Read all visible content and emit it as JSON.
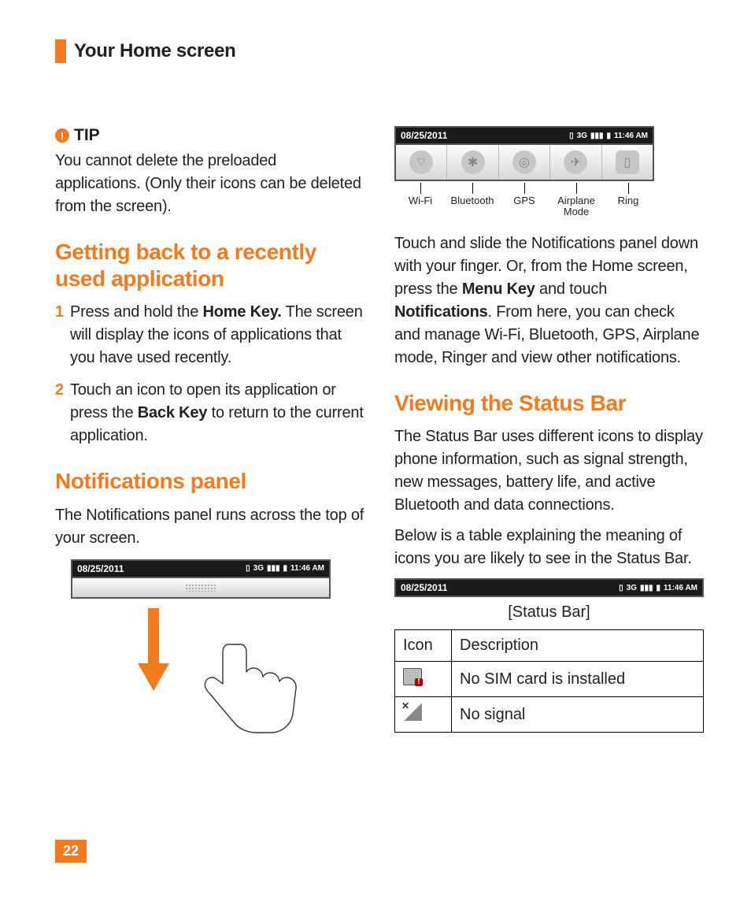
{
  "header": {
    "title": "Your Home screen"
  },
  "tip": {
    "label": "TIP",
    "body": "You cannot delete the preloaded applications. (Only their icons can be deleted from the screen)."
  },
  "section_recent": {
    "heading": "Getting back to a recently used application",
    "step1_num": "1",
    "step1_a": "Press and hold the ",
    "step1_bold": "Home Key.",
    "step1_b": " The screen will display the icons of applications that you have used recently.",
    "step2_num": "2",
    "step2_a": "Touch an icon to open its application or press the ",
    "step2_bold": "Back Key",
    "step2_b": " to return to the current application."
  },
  "section_notif": {
    "heading": "Notifications panel",
    "body": "The Notifications panel runs across the top of your screen."
  },
  "statusbar": {
    "date": "08/25/2011",
    "time": "11:46 AM"
  },
  "quick_labels": {
    "wifi": "Wi-Fi",
    "bluetooth": "Bluetooth",
    "gps": "GPS",
    "airplane": "Airplane Mode",
    "ring": "Ring"
  },
  "notif_desc_a": "Touch and slide the Notifications panel down with your finger. Or, from the Home screen, press the ",
  "notif_desc_bold1": "Menu Key",
  "notif_desc_b": " and touch ",
  "notif_desc_bold2": "Notifications",
  "notif_desc_c": ". From here, you can check and manage Wi-Fi, Bluetooth, GPS, Airplane mode, Ringer and view other notifications.",
  "section_status": {
    "heading": "Viewing the Status Bar",
    "p1": "The Status Bar uses different icons to display phone information, such as signal strength, new messages, battery life, and active Bluetooth and data connections.",
    "p2": "Below is a table explaining the meaning of icons you are likely to see in the Status Bar.",
    "caption": "[Status Bar]"
  },
  "table": {
    "h_icon": "Icon",
    "h_desc": "Description",
    "rows": [
      {
        "desc": "No SIM card is installed"
      },
      {
        "desc": "No signal"
      }
    ]
  },
  "page_number": "22"
}
